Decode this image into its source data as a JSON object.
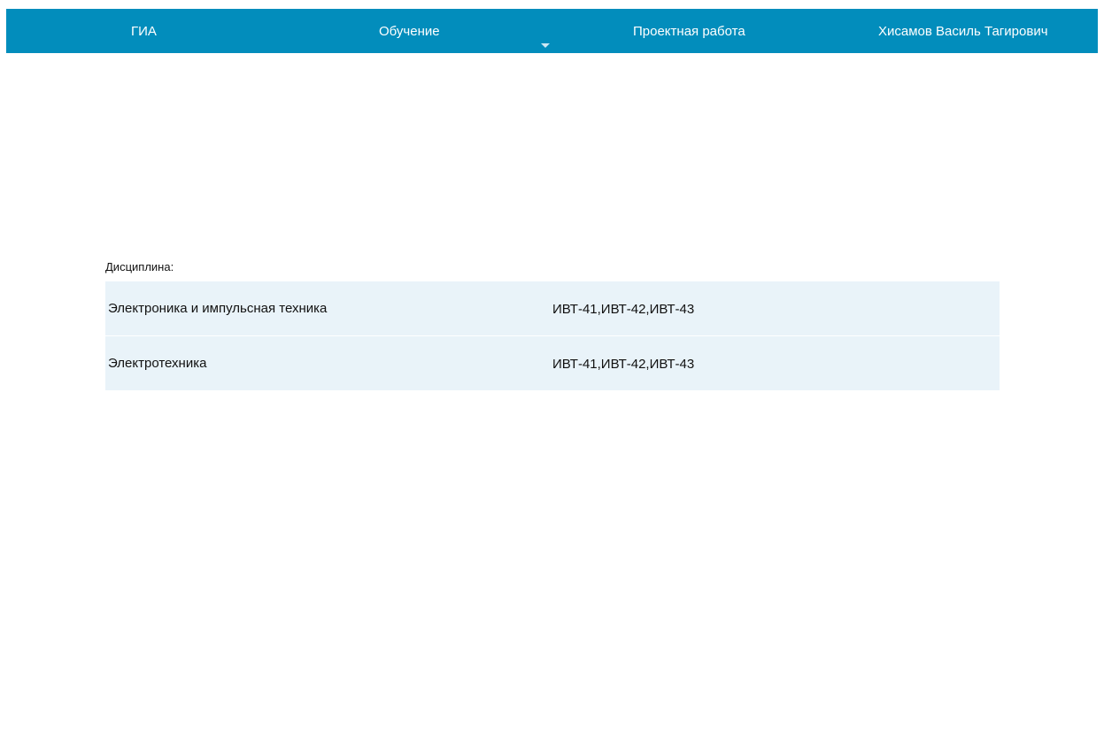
{
  "navbar": {
    "background_color": "#028dbc",
    "items": [
      {
        "label": "ГИА"
      },
      {
        "label": "Обучение"
      },
      {
        "label": "Проектная работа"
      }
    ],
    "user_name": "Хисамов Василь Тагирович",
    "dropdown_icon": "caret-down-icon"
  },
  "disciplines": {
    "label": "Дисциплина:",
    "row_color": "#e9f3f9",
    "rows": [
      {
        "name": "Электроника и импульсная техника",
        "groups": "ИВТ-41,ИВТ-42,ИВТ-43"
      },
      {
        "name": "Электротехника",
        "groups": "ИВТ-41,ИВТ-42,ИВТ-43"
      }
    ]
  }
}
